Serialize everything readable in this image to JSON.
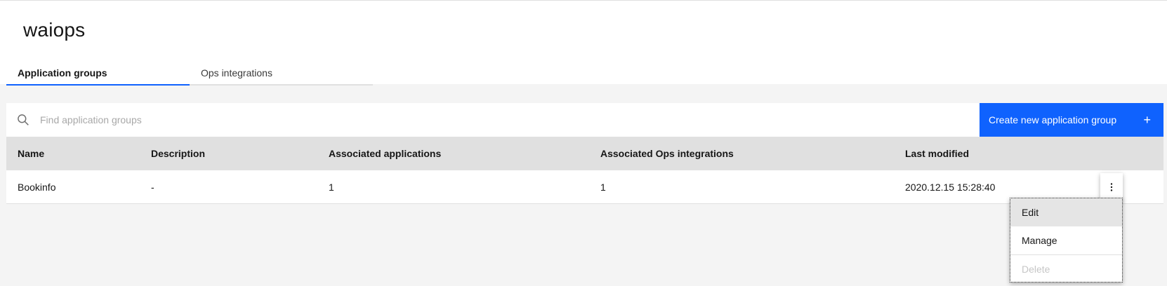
{
  "page": {
    "title": "waiops"
  },
  "tabs": [
    {
      "label": "Application groups",
      "active": true
    },
    {
      "label": "Ops integrations",
      "active": false
    }
  ],
  "toolbar": {
    "search_placeholder": "Find application groups",
    "search_icon": "search-icon",
    "create_label": "Create new application group",
    "create_icon": "+"
  },
  "table": {
    "headers": [
      "Name",
      "Description",
      "Associated applications",
      "Associated Ops integrations",
      "Last modified"
    ],
    "rows": [
      {
        "name": "Bookinfo",
        "description": "-",
        "applications": "1",
        "ops_integrations": "1",
        "last_modified": "2020.12.15 15:28:40"
      }
    ]
  },
  "overflow_menu": {
    "items": [
      {
        "label": "Edit",
        "state": "hover"
      },
      {
        "label": "Manage",
        "state": "normal"
      },
      {
        "label": "Delete",
        "state": "disabled"
      }
    ]
  },
  "colors": {
    "accent": "#0f62fe",
    "header_bg": "#e0e0e0",
    "page_bg": "#f4f4f4"
  }
}
